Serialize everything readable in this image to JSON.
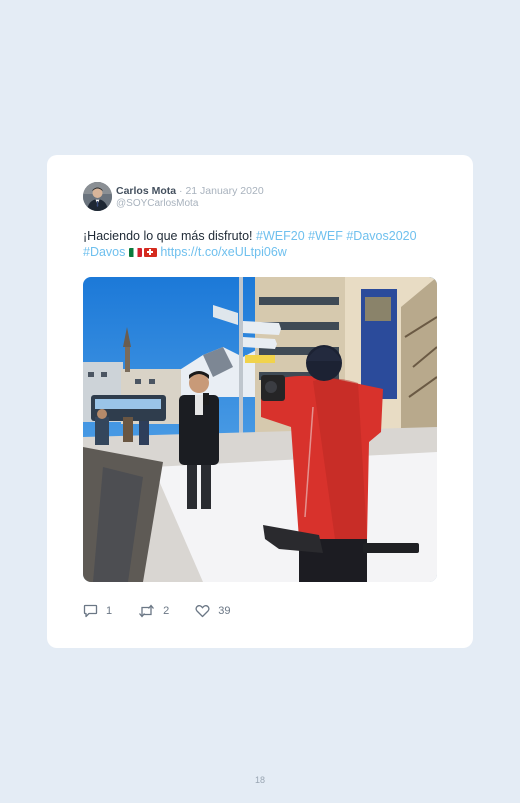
{
  "tweet": {
    "author_name": "Carlos Mota",
    "separator": "·",
    "date": "21 January 2020",
    "handle": "@SOYCarlosMota",
    "text_plain": "¡Haciendo lo que más disfruto! ",
    "hashtag_1": "#WEF20",
    "hashtag_2": "#WEF",
    "hashtag_3": "#Davos2020",
    "hashtag_4": "#Davos",
    "link": "https://t.co/xeULtpi06w",
    "flags": [
      "mexico-flag-icon",
      "switzerland-flag-icon"
    ],
    "photo_alt_icon": "photo-reporter-in-snowy-davos-street"
  },
  "actions": {
    "replies": "1",
    "retweets": "2",
    "likes": "39"
  },
  "page": {
    "number": "18"
  },
  "colors": {
    "background": "#e4ecf5",
    "card": "#ffffff",
    "link": "#6fc0ee",
    "author": "#44505e",
    "muted": "#a8b2bd"
  }
}
